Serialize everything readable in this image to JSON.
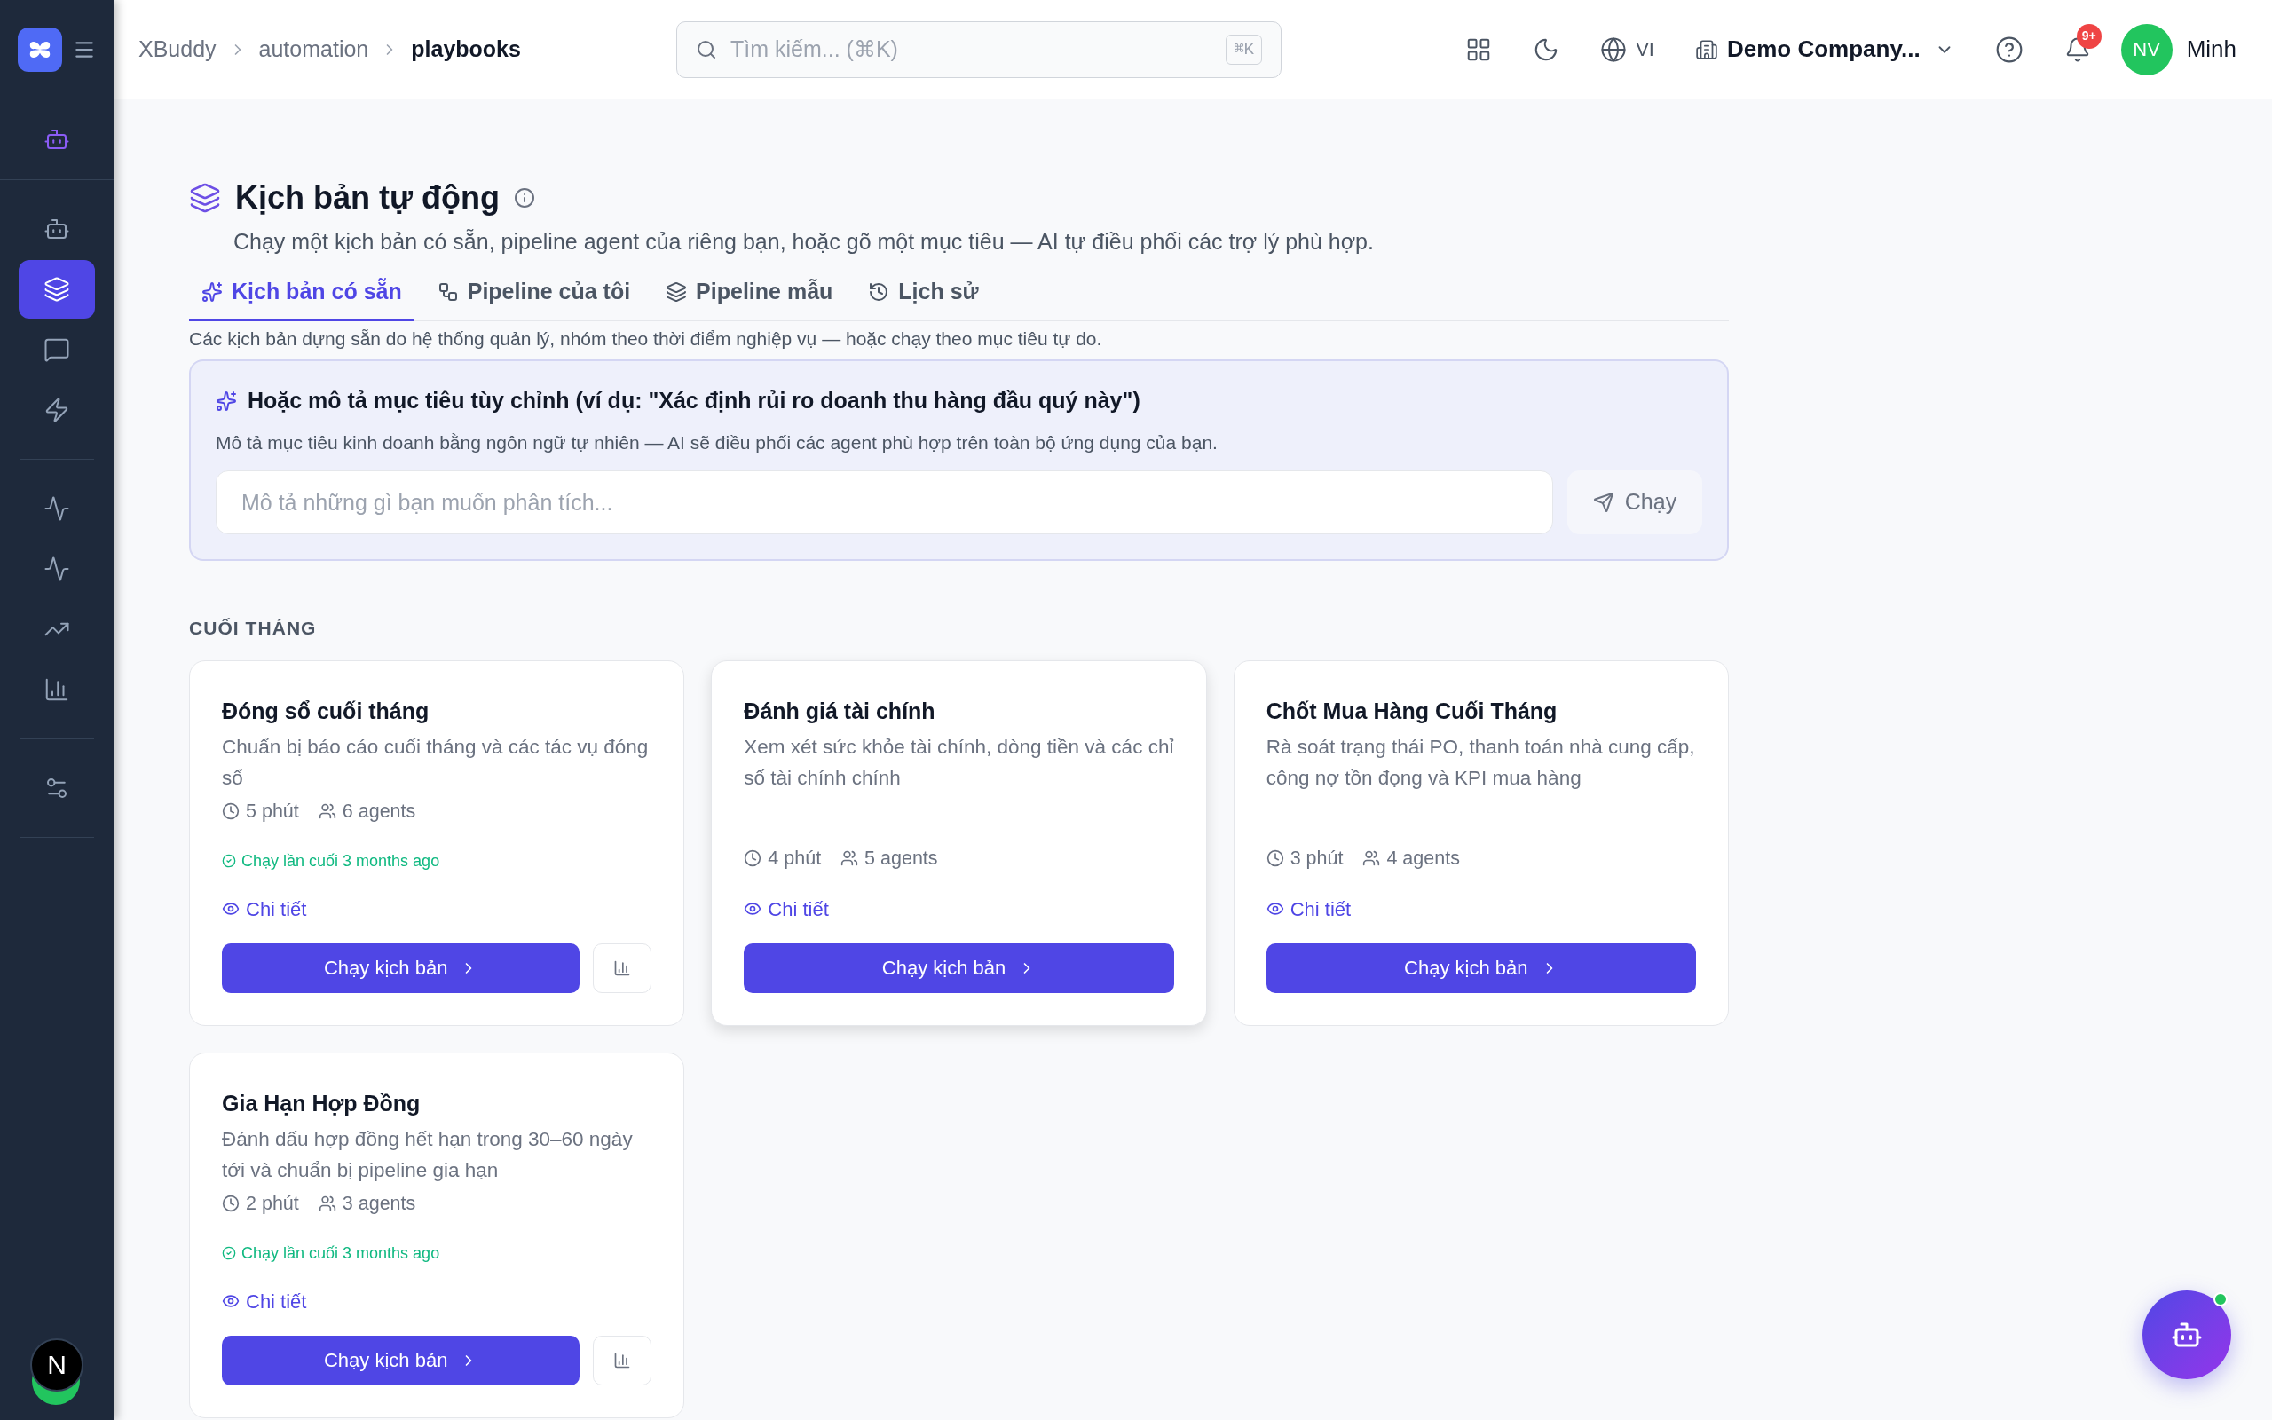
{
  "breadcrumb": [
    {
      "label": "XBuddy",
      "current": false
    },
    {
      "label": "automation",
      "current": false
    },
    {
      "label": "playbooks",
      "current": true
    }
  ],
  "search": {
    "placeholder": "Tìm kiếm... (⌘K)",
    "shortcut": "⌘K"
  },
  "topbar": {
    "language": "VI",
    "company": "Demo Company...",
    "notifications": "9+",
    "user": {
      "initials": "NV",
      "name": "Minh"
    }
  },
  "sidebar": {
    "groups": [
      [
        {
          "selected": false
        }
      ],
      [
        {
          "selected": false
        },
        {
          "selected": true
        },
        {
          "selected": false
        },
        {
          "selected": false
        }
      ],
      [
        {
          "selected": false
        },
        {
          "selected": false
        },
        {
          "selected": false
        },
        {
          "selected": false
        }
      ],
      [
        {
          "selected": false
        }
      ]
    ],
    "user_initial": "N"
  },
  "page": {
    "title": "Kịch bản tự động",
    "subtitle": "Chạy một kịch bản có sẵn, pipeline agent của riêng bạn, hoặc gõ một mục tiêu — AI tự điều phối các trợ lý phù hợp."
  },
  "tabs": [
    {
      "label": "Kịch bản có sẵn",
      "selected": true
    },
    {
      "label": "Pipeline của tôi",
      "selected": false
    },
    {
      "label": "Pipeline mẫu",
      "selected": false
    },
    {
      "label": "Lịch sử",
      "selected": false
    }
  ],
  "tab_description": "Các kịch bản dựng sẵn do hệ thống quản lý, nhóm theo thời điểm nghiệp vụ — hoặc chạy theo mục tiêu tự do.",
  "goal": {
    "title": "Hoặc mô tả mục tiêu tùy chỉnh (ví dụ: \"Xác định rủi ro doanh thu hàng đầu quý này\")",
    "description": "Mô tả mục tiêu kinh doanh bằng ngôn ngữ tự nhiên — AI sẽ điều phối các agent phù hợp trên toàn bộ ứng dụng của bạn.",
    "placeholder": "Mô tả những gì bạn muốn phân tích...",
    "button": "Chạy"
  },
  "section": {
    "title": "CUỐI THÁNG"
  },
  "cards": [
    {
      "title": "Đóng sổ cuối tháng",
      "description": "Chuẩn bị báo cáo cuối tháng và các tác vụ đóng sổ",
      "duration": "5 phút",
      "agents": "6 agents",
      "last_run": "Chạy lần cuối 3 months ago",
      "details": "Chi tiết",
      "button": "Chạy kịch bản",
      "has_report": true,
      "highlighted": false
    },
    {
      "title": "Đánh giá tài chính",
      "description": "Xem xét sức khỏe tài chính, dòng tiền và các chỉ số tài chính chính",
      "duration": "4 phút",
      "agents": "5 agents",
      "details": "Chi tiết",
      "button": "Chạy kịch bản",
      "has_report": false,
      "highlighted": true
    },
    {
      "title": "Chốt Mua Hàng Cuối Tháng",
      "description": "Rà soát trạng thái PO, thanh toán nhà cung cấp, công nợ tồn đọng và KPI mua hàng",
      "duration": "3 phút",
      "agents": "4 agents",
      "details": "Chi tiết",
      "button": "Chạy kịch bản",
      "has_report": false,
      "highlighted": false
    },
    {
      "title": "Gia Hạn Hợp Đồng",
      "description": "Đánh dấu hợp đồng hết hạn trong 30–60 ngày tới và chuẩn bị pipeline gia hạn",
      "duration": "2 phút",
      "agents": "3 agents",
      "last_run": "Chạy lần cuối 3 months ago",
      "details": "Chi tiết",
      "button": "Chạy kịch bản",
      "has_report": true,
      "highlighted": false
    }
  ]
}
